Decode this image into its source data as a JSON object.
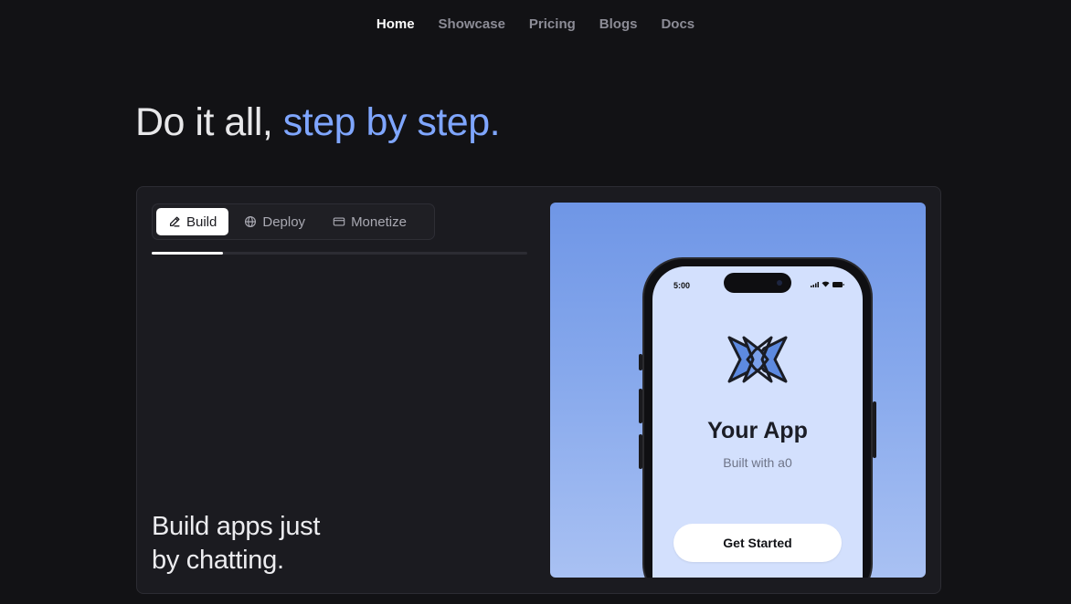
{
  "nav": {
    "items": [
      {
        "label": "Home",
        "active": true
      },
      {
        "label": "Showcase",
        "active": false
      },
      {
        "label": "Pricing",
        "active": false
      },
      {
        "label": "Blogs",
        "active": false
      },
      {
        "label": "Docs",
        "active": false
      }
    ]
  },
  "hero": {
    "heading_plain": "Do it all, ",
    "heading_accent": "step by step.",
    "accent_color": "#7fa6ff"
  },
  "card": {
    "tabs": [
      {
        "label": "Build",
        "icon": "pencil-icon",
        "active": true
      },
      {
        "label": "Deploy",
        "icon": "globe-icon",
        "active": false
      },
      {
        "label": "Monetize",
        "icon": "credit-card-icon",
        "active": false
      }
    ],
    "progress_fraction": 0.19,
    "caption_line1": "Build apps just",
    "caption_line2": "by chatting."
  },
  "preview": {
    "status_time": "5:00",
    "app_logo": "a0-logo-icon",
    "app_title": "Your App",
    "app_subtitle": "Built with a0",
    "cta_label": "Get Started"
  }
}
